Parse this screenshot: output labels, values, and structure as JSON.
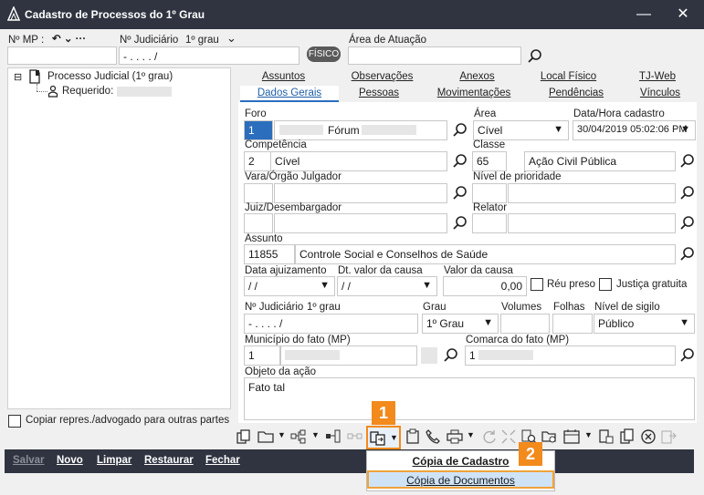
{
  "window": {
    "title": "Cadastro de Processos do 1º Grau",
    "minimize": "—",
    "close": "✕"
  },
  "search": {
    "nmp_label": "Nº MP :",
    "nmp_nav": "↶ ⌄ ···",
    "nj_label": "Nº Judiciário",
    "nj_grau": "1º grau",
    "nj_chev": "⌄",
    "nj_value": "-   .   . . .   /",
    "fisico_badge": "FÍSICO",
    "area_label": "Área de Atuação",
    "area_value": ""
  },
  "tree": {
    "root_label": "Processo Judicial (1º grau)",
    "child_label": "Requerido:",
    "expand": "⊟"
  },
  "tabs_row1": [
    "Assuntos",
    "Observações",
    "Anexos",
    "Local Físico",
    "TJ-Web"
  ],
  "tabs_row2": [
    "Dados Gerais",
    "Pessoas",
    "Movimentações",
    "Pendências",
    "Vínculos"
  ],
  "form": {
    "foro_label": "Foro",
    "foro_code": "1",
    "foro_name_prefix": "Fórum",
    "area_label": "Área",
    "area_value": "Cível",
    "datahora_label": "Data/Hora cadastro",
    "datahora_value": "30/04/2019 05:02:06 PM",
    "competencia_label": "Competência",
    "competencia_code": "2",
    "competencia_name": "Cível",
    "classe_label": "Classe",
    "classe_code": "65",
    "classe_name": "Ação Civil Pública",
    "vara_label": "Vara/Órgão Julgador",
    "prioridade_label": "Nível de prioridade",
    "juiz_label": "Juiz/Desembargador",
    "relator_label": "Relator",
    "assunto_label": "Assunto",
    "assunto_code": "11855",
    "assunto_name": "Controle Social e Conselhos de Saúde",
    "data_ajuiz_label": "Data ajuizamento",
    "data_ajuiz_value": "/ /",
    "dt_valor_label": "Dt. valor da causa",
    "dt_valor_value": "/ /",
    "valor_label": "Valor da causa",
    "valor_value": "0,00",
    "reu_preso": "Réu preso",
    "justica_gratuita": "Justiça gratuita",
    "nj_label": "Nº Judiciário",
    "nj_grau": "1º grau",
    "nj_value": "-   .   . . .   /",
    "grau_label": "Grau",
    "grau_value": "1º Grau",
    "volumes_label": "Volumes",
    "folhas_label": "Folhas",
    "sigilo_label": "Nível de sigilo",
    "sigilo_value": "Público",
    "municipio_label": "Município do fato (MP)",
    "municipio_code": "1",
    "comarca_label": "Comarca do fato (MP)",
    "comarca_code": "1",
    "objeto_label": "Objeto da ação",
    "objeto_value": "Fato tal"
  },
  "left_checkbox": "Copiar repres./advogado para outras partes",
  "bottom": {
    "salvar": "Salvar",
    "novo": "Novo",
    "limpar": "Limpar",
    "restaurar": "Restaurar",
    "fechar": "Fechar"
  },
  "dropdown": {
    "item1": "Cópia de Cadastro",
    "item2": "Cópia de Documentos"
  },
  "callouts": {
    "c1": "1",
    "c2": "2"
  },
  "colors": {
    "titlebar": "#2f3440",
    "accent": "#2a6ebd",
    "callout": "#f28a1c"
  }
}
